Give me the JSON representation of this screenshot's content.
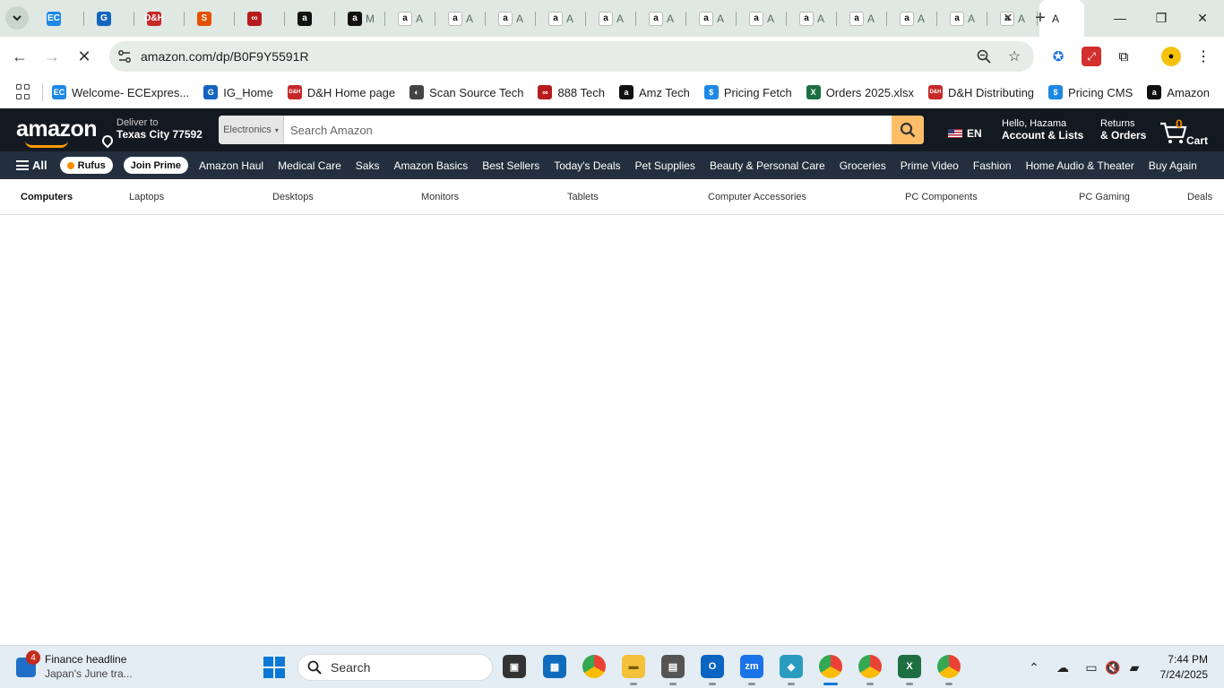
{
  "browser": {
    "tabs": [
      {
        "icon": "ecexpress-icon",
        "label": "EC",
        "color": "#1e88e5",
        "title": ""
      },
      {
        "icon": "ig-icon",
        "label": "G",
        "color": "#1565c0",
        "title": ""
      },
      {
        "icon": "dh-icon",
        "label": "D&H",
        "color": "#c62828",
        "title": ""
      },
      {
        "icon": "scansource-icon",
        "label": "S",
        "color": "#e65100",
        "title": ""
      },
      {
        "icon": "888tech-icon",
        "label": "∞",
        "color": "#b71c1c",
        "title": ""
      },
      {
        "icon": "amazon-icon",
        "label": "a",
        "color": "#111111",
        "title": ""
      },
      {
        "icon": "amazon-icon",
        "label": "a",
        "color": "#111111",
        "title": "M"
      },
      {
        "icon": "amazon-icon",
        "label": "a",
        "color": "#ffffff",
        "title": "A"
      },
      {
        "icon": "amazon-icon",
        "label": "a",
        "color": "#ffffff",
        "title": "A"
      },
      {
        "icon": "amazon-icon",
        "label": "a",
        "color": "#ffffff",
        "title": "A"
      },
      {
        "icon": "amazon-icon",
        "label": "a",
        "color": "#ffffff",
        "title": "A"
      },
      {
        "icon": "amazon-icon",
        "label": "a",
        "color": "#ffffff",
        "title": "A"
      },
      {
        "icon": "amazon-icon",
        "label": "a",
        "color": "#ffffff",
        "title": "A"
      },
      {
        "icon": "amazon-icon",
        "label": "a",
        "color": "#ffffff",
        "title": "A"
      },
      {
        "icon": "amazon-icon",
        "label": "a",
        "color": "#ffffff",
        "title": "A"
      },
      {
        "icon": "amazon-icon",
        "label": "a",
        "color": "#ffffff",
        "title": "A"
      },
      {
        "icon": "amazon-icon",
        "label": "a",
        "color": "#ffffff",
        "title": "A"
      },
      {
        "icon": "amazon-icon",
        "label": "a",
        "color": "#ffffff",
        "title": "A"
      },
      {
        "icon": "amazon-icon",
        "label": "a",
        "color": "#ffffff",
        "title": "A"
      },
      {
        "icon": "amazon-icon",
        "label": "a",
        "color": "#ffffff",
        "title": "A"
      }
    ],
    "active_tab_title": "A",
    "url": "amazon.com/dp/B0F9Y5591R",
    "bookmarks": [
      {
        "icon": "ecexpress-icon",
        "fav": "EC",
        "color": "#1e88e5",
        "label": "Welcome- ECExpres..."
      },
      {
        "icon": "ig-icon",
        "fav": "G",
        "color": "#1565c0",
        "label": "IG_Home"
      },
      {
        "icon": "dh-icon",
        "fav": "D&H",
        "color": "#c62828",
        "label": "D&H Home page"
      },
      {
        "icon": "scansource-icon",
        "fav": "◐",
        "color": "#444444",
        "label": "Scan Source Tech"
      },
      {
        "icon": "888tech-icon",
        "fav": "∞",
        "color": "#b71c1c",
        "label": "888 Tech"
      },
      {
        "icon": "amazon-icon",
        "fav": "a",
        "color": "#111111",
        "label": "Amz Tech"
      },
      {
        "icon": "pricing-icon",
        "fav": "$",
        "color": "#1e88e5",
        "label": "Pricing Fetch"
      },
      {
        "icon": "excel-icon",
        "fav": "X",
        "color": "#1d6f42",
        "label": "Orders 2025.xlsx"
      },
      {
        "icon": "dh-icon",
        "fav": "D&H",
        "color": "#c62828",
        "label": "D&H Distributing"
      },
      {
        "icon": "pricing-icon",
        "fav": "$",
        "color": "#1e88e5",
        "label": "Pricing CMS"
      },
      {
        "icon": "amazon-icon",
        "fav": "a",
        "color": "#111111",
        "label": "Amazon"
      }
    ]
  },
  "amazon": {
    "logo": "amazon",
    "deliver_line1": "Deliver to",
    "deliver_line2": "Texas City 77592",
    "search_category": "Electronics",
    "search_placeholder": "Search Amazon",
    "language": "EN",
    "account_line1": "Hello, Hazama",
    "account_line2": "Account & Lists",
    "returns_line1": "Returns",
    "returns_line2": "& Orders",
    "cart_count": "0",
    "cart_label": "Cart",
    "all_label": "All",
    "rufus_label": "Rufus",
    "join_prime_label": "Join Prime",
    "nav_links": [
      "Amazon Haul",
      "Medical Care",
      "Saks",
      "Amazon Basics",
      "Best Sellers",
      "Today's Deals",
      "Pet Supplies",
      "Beauty & Personal Care",
      "Groceries",
      "Prime Video",
      "Fashion",
      "Home Audio & Theater",
      "Buy Again"
    ],
    "subnav": [
      "Computers",
      "Laptops",
      "Desktops",
      "Monitors",
      "Tablets",
      "Computer Accessories",
      "PC Components",
      "PC Gaming",
      "Deals"
    ]
  },
  "taskbar": {
    "news_title": "Finance headline",
    "news_sub": "Japan's June tra...",
    "news_badge": "4",
    "search_placeholder": "Search",
    "time": "7:44 PM",
    "date": "7/24/2025"
  }
}
